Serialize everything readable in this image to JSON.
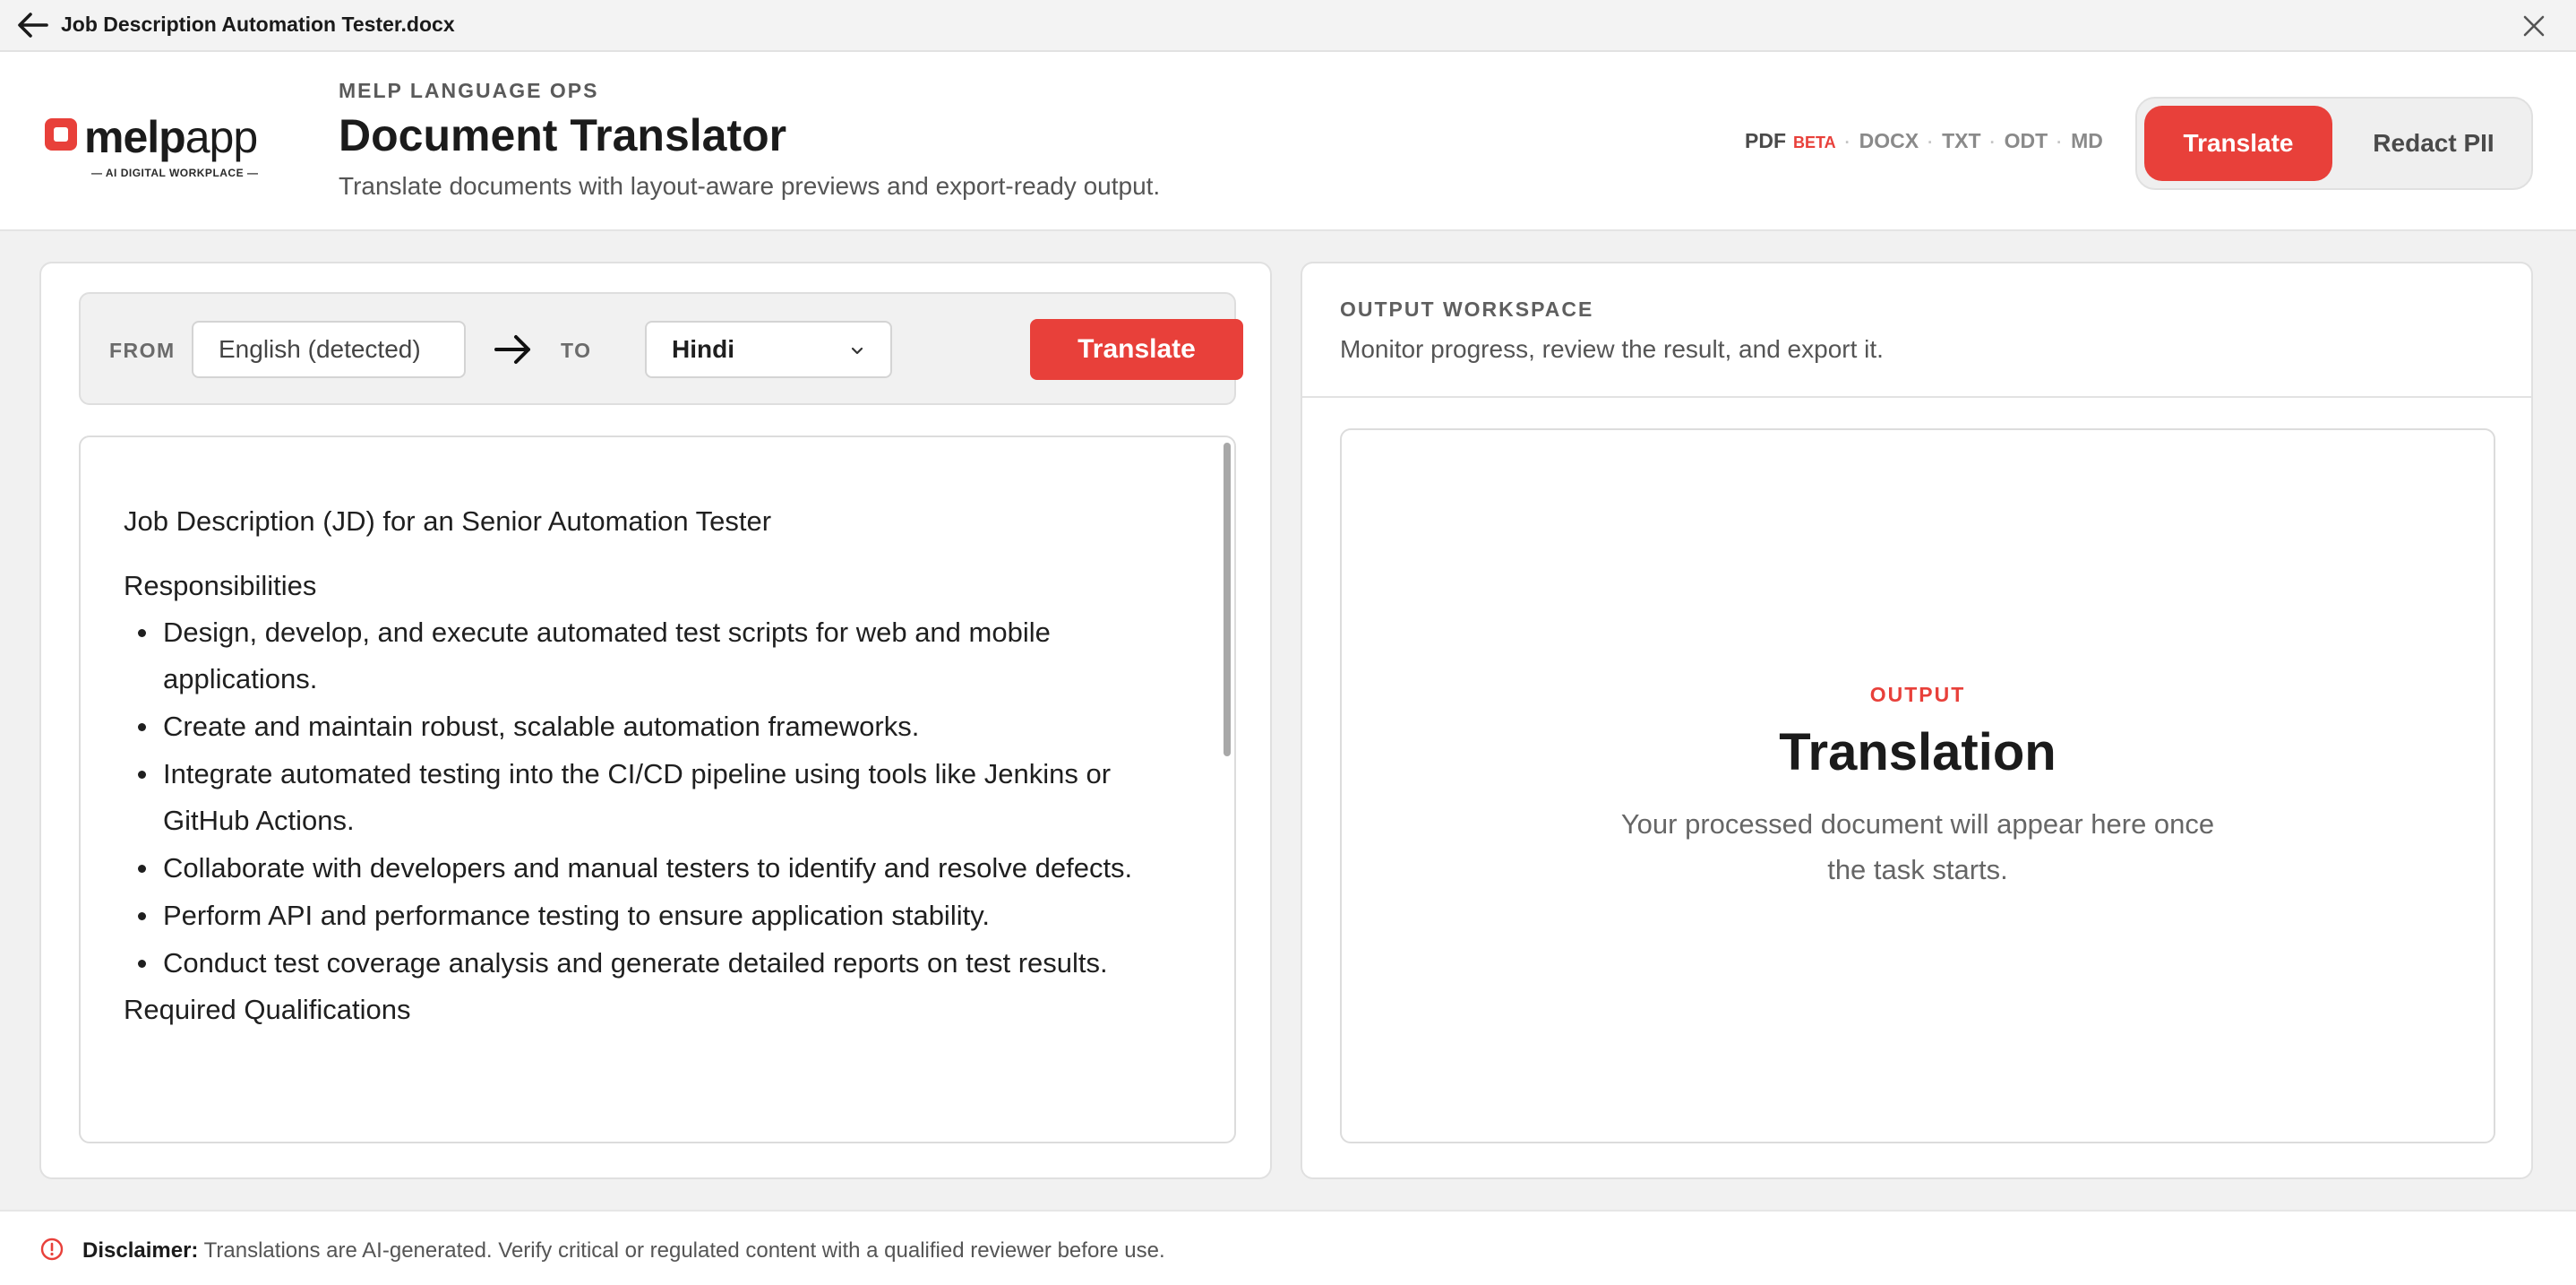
{
  "filebar": {
    "file_name": "Job Description Automation Tester.docx",
    "back_icon": "arrow-left-icon",
    "close_icon": "close-icon"
  },
  "header": {
    "logo": {
      "word_bold": "melp",
      "word_light": "app",
      "tagline": "— AI DIGITAL WORKPLACE —"
    },
    "eyebrow": "MELP LANGUAGE OPS",
    "title": "Document Translator",
    "subtitle": "Translate documents with layout-aware previews and export-ready output.",
    "formats": [
      {
        "label": "PDF",
        "badge": "BETA"
      },
      {
        "label": "DOCX"
      },
      {
        "label": "TXT"
      },
      {
        "label": "ODT"
      },
      {
        "label": "MD"
      }
    ],
    "modes": {
      "active": "Translate",
      "inactive": "Redact PII"
    }
  },
  "toolbar": {
    "from_label": "FROM",
    "source_language": "English (detected)",
    "to_label": "TO",
    "target_language": "Hindi",
    "translate_button": "Translate"
  },
  "document": {
    "heading": "Job Description (JD) for an Senior Automation Tester",
    "section": "Responsibilities",
    "bullets": [
      "Design, develop, and execute automated test scripts for web and mobile applications.",
      "Create and maintain robust, scalable automation frameworks.",
      "Integrate automated testing into the CI/CD pipeline using tools like Jenkins or GitHub Actions.",
      "Collaborate with developers and manual testers to identify and resolve defects.",
      "Perform API and performance testing to ensure application stability.",
      "Conduct test coverage analysis and generate detailed reports on test results."
    ],
    "next_section": "Required Qualifications"
  },
  "output": {
    "eyebrow": "OUTPUT WORKSPACE",
    "description": "Monitor progress, review the result, and export it.",
    "label": "OUTPUT",
    "title": "Translation",
    "message": "Your processed document will appear here once the task starts."
  },
  "footer": {
    "info_icon": "info-icon",
    "disclaimer_label": "Disclaimer:",
    "disclaimer_text": " Translations are AI-generated. Verify critical or regulated content with a qualified reviewer before use."
  },
  "colors": {
    "accent": "#e8403a",
    "background": "#f1f1f1"
  }
}
